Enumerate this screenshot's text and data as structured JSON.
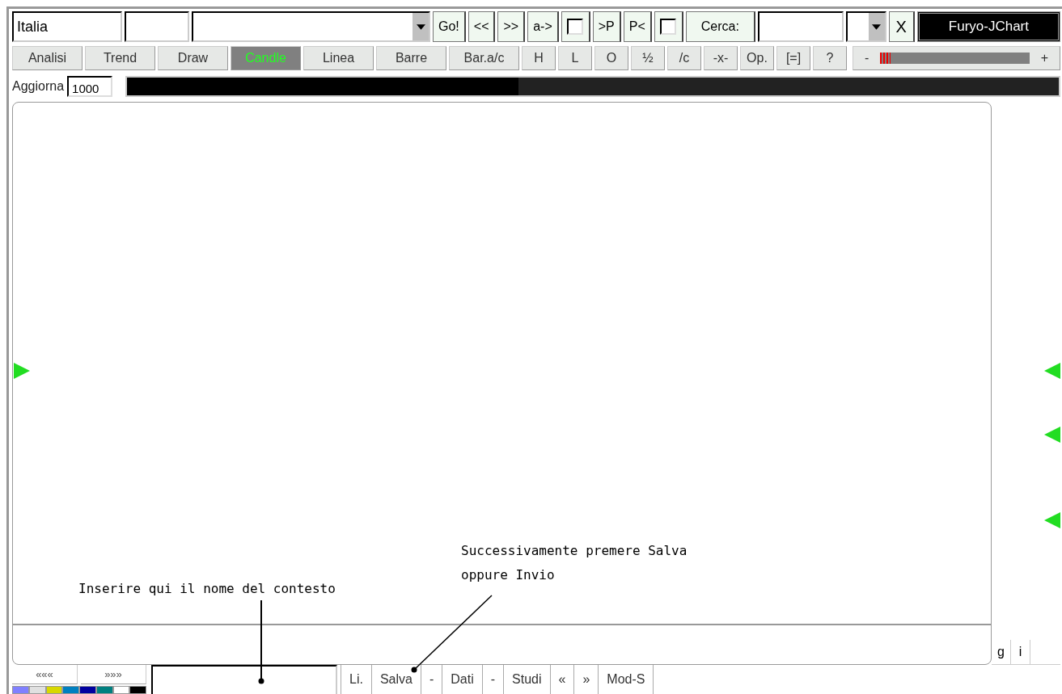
{
  "top_bar": {
    "market_field": {
      "value": "Italia"
    },
    "buttons": [
      "Go!",
      "<<",
      ">>",
      "a->"
    ],
    "checkbox_1": {
      "checked": false
    },
    "buttons_2": [
      ">P",
      "P<"
    ],
    "checkbox_2": {
      "checked": false
    },
    "search_label": "Cerca:",
    "clear_button": "X",
    "brand": "Furyo-JChart"
  },
  "toolbar": {
    "tabs": [
      {
        "label": "Analisi",
        "selected": false
      },
      {
        "label": "Trend",
        "selected": false
      },
      {
        "label": "Draw",
        "selected": false
      },
      {
        "label": "Candle",
        "selected": true
      },
      {
        "label": "Linea",
        "selected": false
      },
      {
        "label": "Barre",
        "selected": false
      },
      {
        "label": "Bar.a/c",
        "selected": false
      },
      {
        "label": "H",
        "selected": false
      },
      {
        "label": "L",
        "selected": false
      },
      {
        "label": "O",
        "selected": false
      },
      {
        "label": "½",
        "selected": false
      },
      {
        "label": "/c",
        "selected": false
      },
      {
        "label": "-x-",
        "selected": false
      },
      {
        "label": "Op.",
        "selected": false
      },
      {
        "label": "[=]",
        "selected": false
      },
      {
        "label": "?",
        "selected": false
      }
    ],
    "zoom": {
      "minus": "-",
      "level": 0.07,
      "plus": "+"
    }
  },
  "refresh": {
    "label": "Aggiorna",
    "interval": "1000",
    "progress": {
      "level": 0.42
    }
  },
  "side_buttons": [
    "g",
    "i"
  ],
  "bottom_bar": {
    "nav_buttons": [
      "«««",
      "»»»"
    ],
    "palette": [
      {
        "color": "#8080ff"
      },
      {
        "color": "#e0e0e0"
      },
      {
        "color": "#d8d800"
      },
      {
        "color": "#0080c0"
      },
      {
        "color": "#0000a0"
      },
      {
        "color": "#008080"
      },
      {
        "color": "#ffffff"
      },
      {
        "color": "#000000"
      }
    ],
    "buttons": [
      "Li.",
      "Salva",
      "-",
      "Dati",
      "-",
      "Studi",
      "«",
      "»",
      "Mod-S"
    ]
  },
  "annotations": [
    {
      "text": "Inserire qui il nome del contesto"
    },
    {
      "text": "Successivamente premere Salva\noppure Invio"
    }
  ]
}
